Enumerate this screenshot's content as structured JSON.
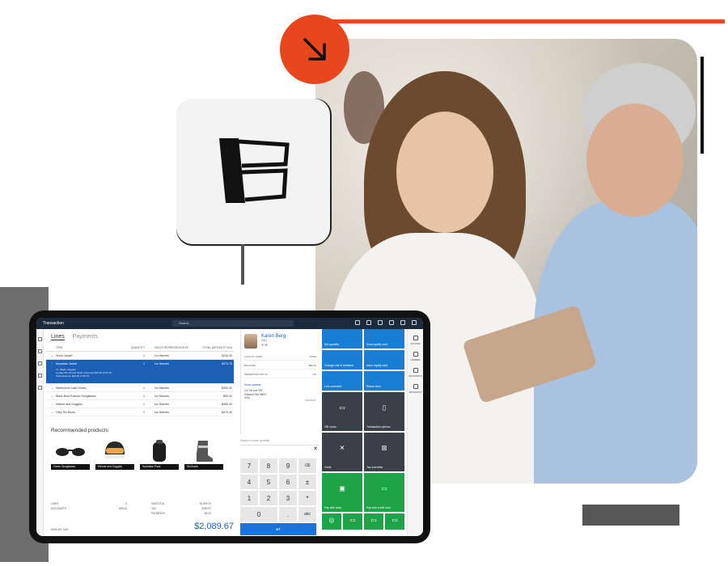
{
  "colors": {
    "accent": "#e8461c",
    "pos_blue": "#1b5fb7",
    "tile_blue": "#1a7fd4",
    "tile_green": "#1fa347",
    "tile_dark": "#3a4047"
  },
  "decor": {
    "arrow_icon": "arrow-down-right-icon",
    "logo_icon": "brand-logo-icon"
  },
  "pos": {
    "title": "Transaction",
    "search_placeholder": "Search",
    "tabs": [
      "Lines",
      "Payments"
    ],
    "columns": [
      "ITEM",
      "QUANTITY",
      "SALES REPRESENTATIVE",
      "TOTAL (WITHOUT TAX)"
    ],
    "lines": [
      {
        "item": "Snow Jacket",
        "qty": "1",
        "rep": "Ivo Hamels",
        "total": "$240.00"
      },
      {
        "item": "Mountain Jacket",
        "qty": "1",
        "rep": "Ivo Hamels",
        "total": "$270.70",
        "selected": true,
        "detail1": "XL, Black, Regular",
        "detail2": "Loyalty 5% off over $100 | Discount $15.00 (5.00 %)",
        "detail3": "Total discount: $29.30 (7.00 %)"
      },
      {
        "item": "Waterproof Lace Shoes",
        "qty": "1",
        "rep": "Ivo Hamels",
        "total": "$300.00"
      },
      {
        "item": "Black Bold Framed Sunglasses",
        "qty": "1",
        "rep": "Ivo Hamels",
        "total": "$90.00"
      },
      {
        "item": "Helmet and Goggles",
        "qty": "1",
        "rep": "Ivo Hamels",
        "total": "$480.00"
      },
      {
        "item": "Grey Ski Boots",
        "qty": "1",
        "rep": "Ivo Hamels",
        "total": "$470.00"
      }
    ],
    "recommended_title": "Recommended products",
    "recommended": [
      "Green Sunglasses",
      "Helmet and Goggles",
      "Hydration Pack",
      "Ski Boots"
    ],
    "totals": {
      "lines_label": "LINES",
      "lines_value": "6",
      "discounts_label": "DISCOUNTS",
      "discounts_value": "$35.00",
      "subtotal_label": "SUBTOTAL",
      "subtotal_value": "$1,899.70",
      "tax_label": "TAX",
      "tax_value": "$189.97",
      "payments_label": "PAYMENTS",
      "payments_value": "$0.00",
      "amount_due_label": "AMOUNT DUE",
      "amount_due_value": "$2,089.67"
    },
    "customer": {
      "name": "Karen Berg",
      "id": "2001",
      "loyalty_label": "LOYALTY CARD",
      "loyalty_value": "33333",
      "balance_label": "BALANCE",
      "balance_value": "$89.00",
      "marketing_label": "MARKETING OPT IN",
      "marketing_value": "NO",
      "address_title": "Home address",
      "address_line1": "112 1st Ave SW",
      "address_line2": "Kirkland, WA 98007",
      "address_line3": "USA",
      "address_tag": "PRIMARY"
    },
    "numpad": {
      "search_placeholder": "Search or enter quantity",
      "keys": [
        "7",
        "8",
        "9",
        "⌫",
        "4",
        "5",
        "6",
        "±",
        "1",
        "2",
        "3",
        "*",
        "0",
        ".",
        "abc"
      ],
      "enter_symbol": "↵"
    },
    "tiles": {
      "set_quantity": "Set quantity",
      "scan_loyalty": "Scan loyalty card",
      "change_uom": "Change unit of measure",
      "issue_loyalty": "Issue loyalty card",
      "line_comment": "Line comment",
      "return_item": "Return item",
      "gift_cards": "Gift cards",
      "transaction_options": "Transaction options",
      "voids": "Voids",
      "tax_overrides": "Tax overrides",
      "pay_cash": "Pay with cash",
      "pay_card": "Pay with credit card"
    },
    "rightbar": [
      "ACTIONS",
      "ORDERS",
      "DISCOUNTS",
      "PRODUCTS"
    ]
  }
}
